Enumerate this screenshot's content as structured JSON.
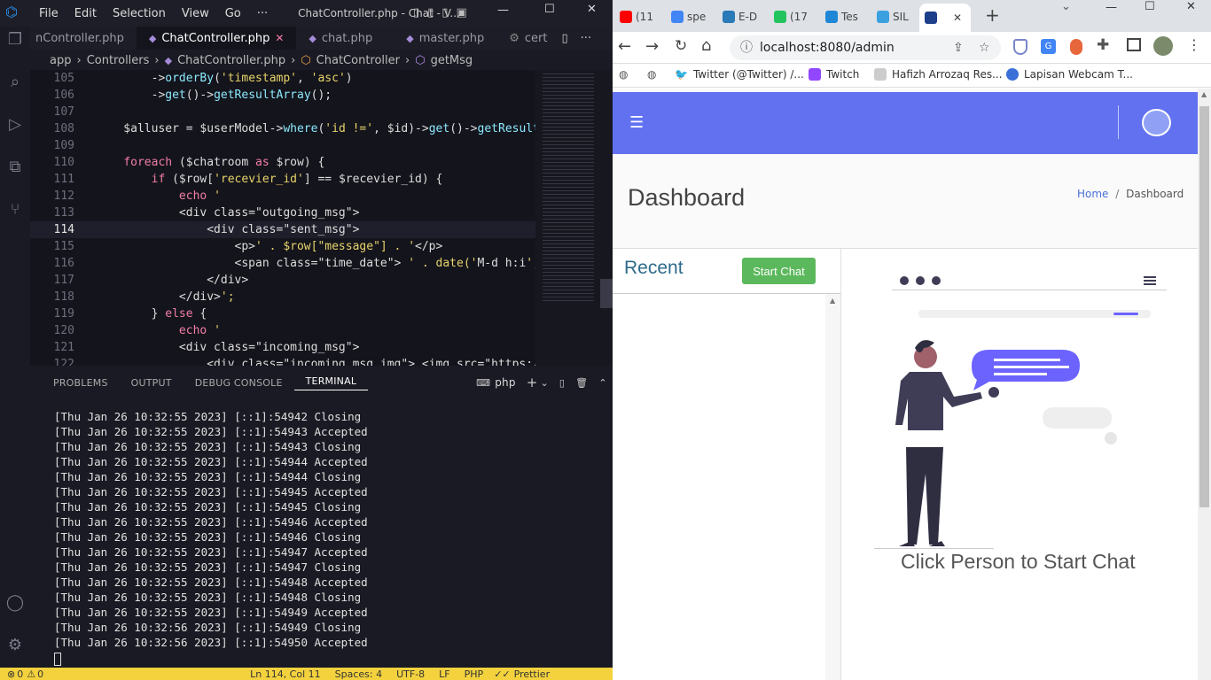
{
  "vscode": {
    "menu": [
      "File",
      "Edit",
      "Selection",
      "View",
      "Go",
      "···"
    ],
    "window_title": "ChatController.php - Chat - V...",
    "tabs": [
      {
        "label": "nController.php",
        "active": false
      },
      {
        "label": "ChatController.php",
        "active": true,
        "close": "✕"
      },
      {
        "label": "chat.php",
        "active": false
      },
      {
        "label": "master.php",
        "active": false
      },
      {
        "label": "cert",
        "active": false
      }
    ],
    "breadcrumb": [
      "app",
      "Controllers",
      "ChatController.php",
      "ChatController",
      "getMsg"
    ],
    "code_lines": [
      {
        "num": "105",
        "text": "        ->orderBy('timestamp', 'asc')"
      },
      {
        "num": "106",
        "text": "        ->get()->getResultArray();"
      },
      {
        "num": "107",
        "text": ""
      },
      {
        "num": "108",
        "text": "    $alluser = $userModel->where('id !=', $id)->get()->getResultA"
      },
      {
        "num": "109",
        "text": ""
      },
      {
        "num": "110",
        "text": "    foreach ($chatroom as $row) {"
      },
      {
        "num": "111",
        "text": "        if ($row['recevier_id'] == $recevier_id) {"
      },
      {
        "num": "112",
        "text": "            echo '"
      },
      {
        "num": "113",
        "text": "            <div class=\"outgoing_msg\">"
      },
      {
        "num": "114",
        "text": "                <div class=\"sent_msg\">"
      },
      {
        "num": "115",
        "text": "                    <p>' . $row[\"message\"] . '</p>"
      },
      {
        "num": "116",
        "text": "                    <span class=\"time_date\"> ' . date('M-d h:i',"
      },
      {
        "num": "117",
        "text": "                </div>"
      },
      {
        "num": "118",
        "text": "            </div>';"
      },
      {
        "num": "119",
        "text": "        } else {"
      },
      {
        "num": "120",
        "text": "            echo '"
      },
      {
        "num": "121",
        "text": "            <div class=\"incoming_msg\">"
      },
      {
        "num": "122",
        "text": "                <div class=\"incoming_msg_img\"> <img src=\"https://"
      }
    ],
    "current_line": "114",
    "panel_tabs": [
      "PROBLEMS",
      "OUTPUT",
      "DEBUG CONSOLE",
      "TERMINAL"
    ],
    "active_panel": "TERMINAL",
    "terminal_shell": "php",
    "terminal_lines": [
      "[Thu Jan 26 10:32:55 2023] [::1]:54942 Closing",
      "[Thu Jan 26 10:32:55 2023] [::1]:54943 Accepted",
      "[Thu Jan 26 10:32:55 2023] [::1]:54943 Closing",
      "[Thu Jan 26 10:32:55 2023] [::1]:54944 Accepted",
      "[Thu Jan 26 10:32:55 2023] [::1]:54944 Closing",
      "[Thu Jan 26 10:32:55 2023] [::1]:54945 Accepted",
      "[Thu Jan 26 10:32:55 2023] [::1]:54945 Closing",
      "[Thu Jan 26 10:32:55 2023] [::1]:54946 Accepted",
      "[Thu Jan 26 10:32:55 2023] [::1]:54946 Closing",
      "[Thu Jan 26 10:32:55 2023] [::1]:54947 Accepted",
      "[Thu Jan 26 10:32:55 2023] [::1]:54947 Closing",
      "[Thu Jan 26 10:32:55 2023] [::1]:54948 Accepted",
      "[Thu Jan 26 10:32:55 2023] [::1]:54948 Closing",
      "[Thu Jan 26 10:32:55 2023] [::1]:54949 Accepted",
      "[Thu Jan 26 10:32:56 2023] [::1]:54949 Closing",
      "[Thu Jan 26 10:32:56 2023] [::1]:54950 Accepted"
    ],
    "status": {
      "errors": "0",
      "warnings": "0",
      "position": "Ln 114, Col 11",
      "spaces": "Spaces: 4",
      "encoding": "UTF-8",
      "eol": "LF",
      "language": "PHP",
      "prettier": "Prettier"
    }
  },
  "chrome": {
    "tabs": [
      {
        "label": "(11",
        "color": "#ff0000"
      },
      {
        "label": "spe",
        "color": "#4285f4"
      },
      {
        "label": "E-D",
        "color": "#2a7ab8"
      },
      {
        "label": "(17",
        "color": "#23c45e"
      },
      {
        "label": "Tes",
        "color": "#1f87d6"
      },
      {
        "label": "SIL",
        "color": "#3aa0e0"
      },
      {
        "label": "",
        "color": "#1d3f8a",
        "active": true,
        "close": "✕"
      }
    ],
    "new_tab": "+",
    "url": "localhost:8080/admin",
    "bookmarks": [
      "Twitter (@Twitter) /...",
      "Twitch",
      "Hafizh Arrozaq Res...",
      "Lapisan Webcam T..."
    ]
  },
  "app": {
    "page_title": "Dashboard",
    "breadcrumb_home": "Home",
    "breadcrumb_sep": "/",
    "breadcrumb_current": "Dashboard",
    "recent_heading": "Recent",
    "start_chat_label": "Start Chat",
    "empty_state_text": "Click Person to Start Chat",
    "accent_color": "#6171f0",
    "button_color": "#5cb85c"
  }
}
